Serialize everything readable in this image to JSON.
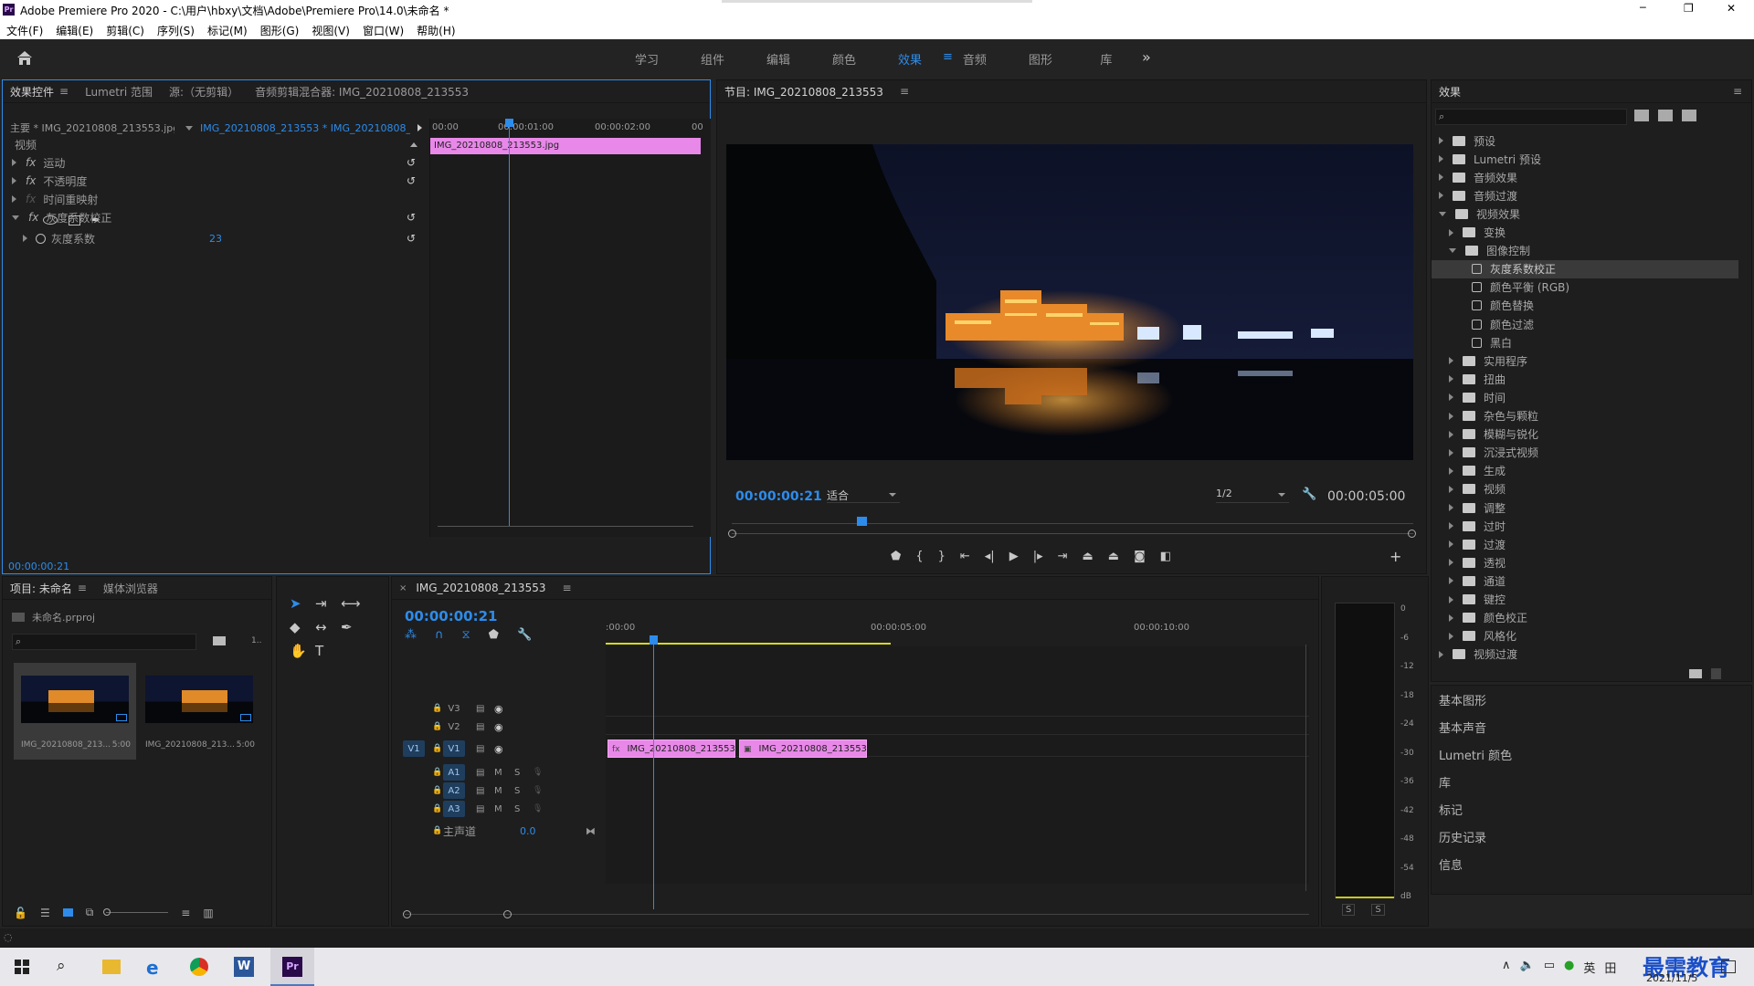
{
  "app": {
    "title": "Adobe Premiere Pro 2020 - C:\\用户\\hbxy\\文档\\Adobe\\Premiere Pro\\14.0\\未命名 *",
    "icon_text": "Pr"
  },
  "window_controls": {
    "minimize": "─",
    "maximize": "❐",
    "close": "✕"
  },
  "menu": [
    "文件(F)",
    "编辑(E)",
    "剪辑(C)",
    "序列(S)",
    "标记(M)",
    "图形(G)",
    "视图(V)",
    "窗口(W)",
    "帮助(H)"
  ],
  "workspaces": {
    "tabs": [
      "学习",
      "组件",
      "编辑",
      "颜色",
      "效果",
      "音频",
      "图形",
      "库"
    ],
    "active": "效果",
    "more": "»"
  },
  "effect_controls": {
    "tabs": [
      "效果控件",
      "Lumetri 范围",
      "源:（无剪辑）",
      "音频剪辑混合器: IMG_20210808_213553"
    ],
    "master": "主要 * IMG_20210808_213553.jpg",
    "sequence": "IMG_20210808_213553 * IMG_20210808_...",
    "ruler": [
      "00:00",
      "00:00:01:00",
      "00:00:02:00",
      "00"
    ],
    "clip_label": "IMG_20210808_213553.jpg",
    "section": "视频",
    "effects": [
      "运动",
      "不透明度",
      "时间重映射",
      "灰度系数校正"
    ],
    "param_name": "灰度系数",
    "param_value": "23",
    "timecode": "00:00:00:21"
  },
  "program": {
    "title": "节目: IMG_20210808_213553",
    "timecode": "00:00:00:21",
    "fit": "适合",
    "resolution": "1/2",
    "duration": "00:00:05:00",
    "playhead_fraction": 0.19
  },
  "project": {
    "tabs": [
      "项目: 未命名",
      "媒体浏览器"
    ],
    "file": "未命名.prproj",
    "items": [
      {
        "name": "IMG_20210808_213...",
        "dur": "5:00"
      },
      {
        "name": "IMG_20210808_213...",
        "dur": "5:00"
      }
    ]
  },
  "timeline": {
    "tab": "IMG_20210808_213553",
    "timecode": "00:00:00:21",
    "ruler": [
      ":00:00",
      "00:00:05:00",
      "00:00:10:00"
    ],
    "video_tracks": [
      "V3",
      "V2",
      "V1"
    ],
    "audio_tracks": [
      "A1",
      "A2",
      "A3"
    ],
    "src_patch": "V1",
    "master": "主声道",
    "master_value": "0.0",
    "clips": [
      "IMG_20210808_213553.jpg",
      "IMG_20210808_213553.j"
    ],
    "track_toggles": {
      "mute": "M",
      "solo": "S"
    }
  },
  "meter": {
    "scale": [
      "0",
      "-6",
      "-12",
      "-18",
      "-24",
      "-30",
      "-36",
      "-42",
      "-48",
      "-54",
      "dB"
    ],
    "solo": [
      "S",
      "S"
    ]
  },
  "effects_panel": {
    "title": "效果",
    "tree": [
      {
        "label": "预设",
        "level": 0,
        "open": false,
        "type": "folder"
      },
      {
        "label": "Lumetri 预设",
        "level": 0,
        "open": false,
        "type": "folder"
      },
      {
        "label": "音频效果",
        "level": 0,
        "open": false,
        "type": "folder"
      },
      {
        "label": "音频过渡",
        "level": 0,
        "open": false,
        "type": "folder"
      },
      {
        "label": "视频效果",
        "level": 0,
        "open": true,
        "type": "folder"
      },
      {
        "label": "变换",
        "level": 1,
        "open": false,
        "type": "folder"
      },
      {
        "label": "图像控制",
        "level": 1,
        "open": true,
        "type": "folder"
      },
      {
        "label": "灰度系数校正",
        "level": 2,
        "type": "fx",
        "selected": true
      },
      {
        "label": "颜色平衡 (RGB)",
        "level": 2,
        "type": "fx"
      },
      {
        "label": "颜色替换",
        "level": 2,
        "type": "fx"
      },
      {
        "label": "颜色过滤",
        "level": 2,
        "type": "fx"
      },
      {
        "label": "黑白",
        "level": 2,
        "type": "fx"
      },
      {
        "label": "实用程序",
        "level": 1,
        "open": false,
        "type": "folder"
      },
      {
        "label": "扭曲",
        "level": 1,
        "open": false,
        "type": "folder"
      },
      {
        "label": "时间",
        "level": 1,
        "open": false,
        "type": "folder"
      },
      {
        "label": "杂色与颗粒",
        "level": 1,
        "open": false,
        "type": "folder"
      },
      {
        "label": "模糊与锐化",
        "level": 1,
        "open": false,
        "type": "folder"
      },
      {
        "label": "沉浸式视频",
        "level": 1,
        "open": false,
        "type": "folder"
      },
      {
        "label": "生成",
        "level": 1,
        "open": false,
        "type": "folder"
      },
      {
        "label": "视频",
        "level": 1,
        "open": false,
        "type": "folder"
      },
      {
        "label": "调整",
        "level": 1,
        "open": false,
        "type": "folder"
      },
      {
        "label": "过时",
        "level": 1,
        "open": false,
        "type": "folder"
      },
      {
        "label": "过渡",
        "level": 1,
        "open": false,
        "type": "folder"
      },
      {
        "label": "透视",
        "level": 1,
        "open": false,
        "type": "folder"
      },
      {
        "label": "通道",
        "level": 1,
        "open": false,
        "type": "folder"
      },
      {
        "label": "键控",
        "level": 1,
        "open": false,
        "type": "folder"
      },
      {
        "label": "颜色校正",
        "level": 1,
        "open": false,
        "type": "folder"
      },
      {
        "label": "风格化",
        "level": 1,
        "open": false,
        "type": "folder"
      },
      {
        "label": "视频过渡",
        "level": 0,
        "open": false,
        "type": "folder"
      }
    ],
    "collapsed_panels": [
      "基本图形",
      "基本声音",
      "Lumetri 颜色",
      "库",
      "标记",
      "历史记录",
      "信息"
    ]
  },
  "taskbar": {
    "apps": [
      "W",
      "Pr"
    ],
    "tray": {
      "ime": "英",
      "ime2": "田"
    },
    "date": "2021/11/5",
    "watermark": "最需教育"
  },
  "colors": {
    "accent": "#2d8ceb",
    "clip": "#e888e8",
    "panel": "#1e1e1e",
    "bg": "#232323"
  }
}
